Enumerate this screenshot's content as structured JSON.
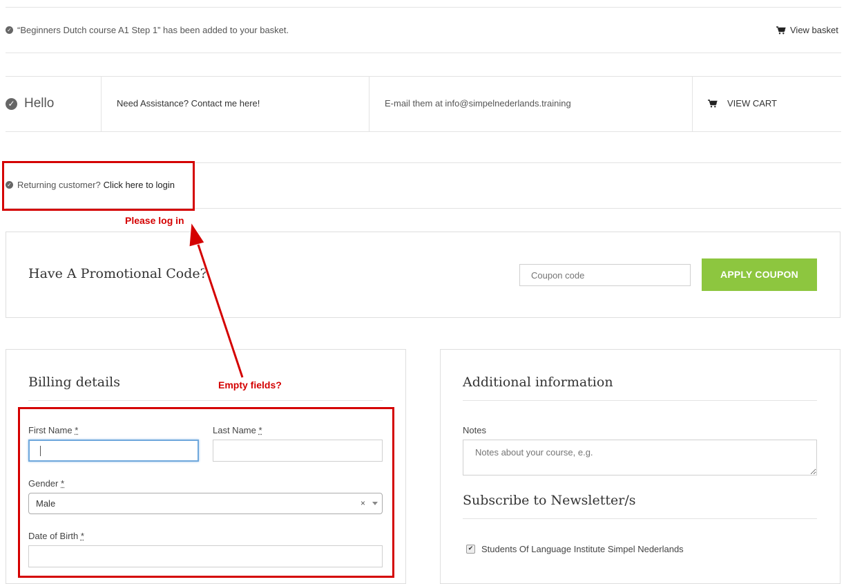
{
  "notice": {
    "message": "“Beginners Dutch course A1 Step 1” has been added to your basket.",
    "view_basket": "View basket"
  },
  "topbar": {
    "hello": "Hello",
    "assistance": "Need Assistance? Contact me here!",
    "email": "E-mail them at info@simpelnederlands.training",
    "view_cart": "VIEW CART"
  },
  "login": {
    "prefix": "Returning customer?",
    "link": "Click here to login"
  },
  "promo": {
    "heading": "Have A Promotional Code?",
    "coupon_placeholder": "Coupon code",
    "apply_label": "APPLY COUPON"
  },
  "billing": {
    "heading": "Billing details",
    "first_name_label": "First Name",
    "last_name_label": "Last Name",
    "gender_label": "Gender",
    "gender_value": "Male",
    "dob_label": "Date of Birth",
    "required_mark": "*"
  },
  "additional": {
    "heading": "Additional information",
    "notes_label": "Notes",
    "notes_placeholder": "Notes about your course, e.g.",
    "newsletter_heading": "Subscribe to Newsletter/s",
    "newsletter_option": "Students Of Language Institute Simpel Nederlands",
    "newsletter_checked": true
  },
  "annotations": {
    "login_note": "Please log in",
    "fields_note": "Empty fields?",
    "color": "#d40000"
  },
  "colors": {
    "accent_green": "#8dc63f",
    "focus_blue": "#6fa8dc"
  }
}
